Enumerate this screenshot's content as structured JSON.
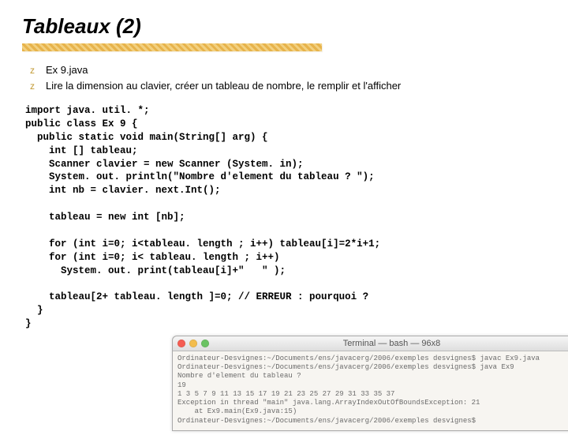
{
  "title": "Tableaux (2)",
  "bullets": {
    "marker": "z",
    "items": [
      "Ex 9.java",
      "Lire la dimension au clavier, créer un tableau de nombre, le remplir et l'afficher"
    ]
  },
  "code_lines": [
    "import java. util. *;",
    "public class Ex 9 {",
    "  public static void main(String[] arg) {",
    "    int [] tableau;",
    "    Scanner clavier = new Scanner (System. in);",
    "    System. out. println(\"Nombre d'element du tableau ? \");",
    "    int nb = clavier. next.Int();",
    "",
    "    tableau = new int [nb];",
    "",
    "    for (int i=0; i<tableau. length ; i++) tableau[i]=2*i+1;",
    "    for (int i=0; i< tableau. length ; i++)",
    "      System. out. print(tableau[i]+\"   \" );",
    "",
    "    tableau[2+ tableau. length ]=0; // ERREUR : pourquoi ?",
    "  }",
    "}"
  ],
  "terminal": {
    "title": "Terminal — bash — 96x8",
    "lines": [
      "Ordinateur-Desvignes:~/Documents/ens/javacerg/2006/exemples desvignes$ javac Ex9.java",
      "Ordinateur-Desvignes:~/Documents/ens/javacerg/2006/exemples desvignes$ java Ex9",
      "Nombre d'element du tableau ?",
      "19",
      "1 3 5 7 9 11 13 15 17 19 21 23 25 27 29 31 33 35 37",
      "Exception in thread \"main\" java.lang.ArrayIndexOutOfBoundsException: 21",
      "    at Ex9.main(Ex9.java:15)",
      "Ordinateur-Desvignes:~/Documents/ens/javacerg/2006/exemples desvignes$"
    ]
  }
}
